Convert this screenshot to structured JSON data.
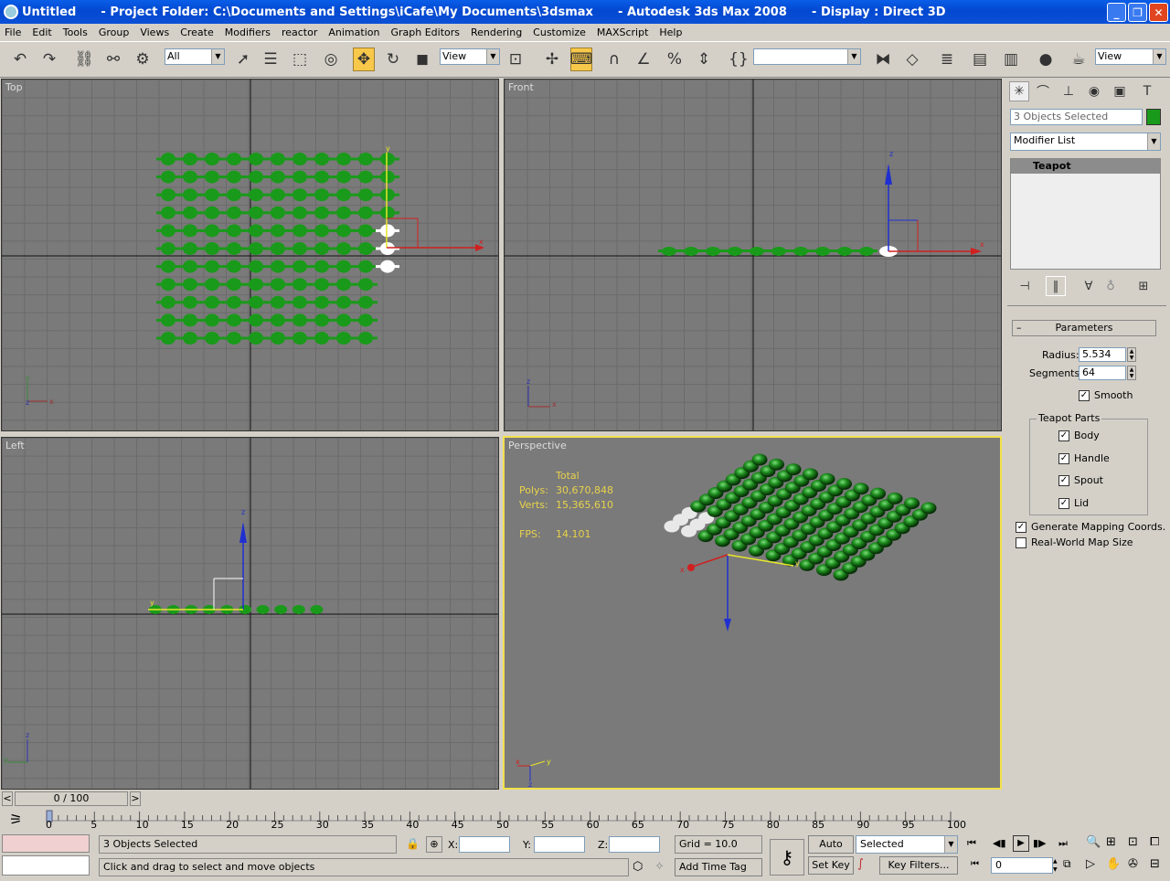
{
  "title": {
    "text": "Untitled      - Project Folder: C:\\Documents and Settings\\iCafe\\My Documents\\3dsmax      - Autodesk 3ds Max 2008      - Display : Direct 3D"
  },
  "menu": [
    "File",
    "Edit",
    "Tools",
    "Group",
    "Views",
    "Create",
    "Modifiers",
    "reactor",
    "Animation",
    "Graph Editors",
    "Rendering",
    "Customize",
    "MAXScript",
    "Help"
  ],
  "toolbar": {
    "filter": "All",
    "coord": "View",
    "coord2": "View"
  },
  "viewports": {
    "top": "Top",
    "front": "Front",
    "left": "Left",
    "perspective": "Perspective"
  },
  "stats": {
    "total": "Total",
    "polys_label": "Polys:",
    "polys": "30,670,848",
    "verts_label": "Verts:",
    "verts": "15,365,610",
    "fps_label": "FPS:",
    "fps": "14.101"
  },
  "panel": {
    "selection": "3 Objects Selected",
    "modifier_list": "Modifier List",
    "stack_item": "Teapot",
    "params_title": "Parameters",
    "radius_label": "Radius:",
    "radius": "5.534",
    "segments_label": "Segments:",
    "segments": "64",
    "smooth": "Smooth",
    "parts_title": "Teapot Parts",
    "body": "Body",
    "handle": "Handle",
    "spout": "Spout",
    "lid": "Lid",
    "gen_map": "Generate Mapping Coords.",
    "real_world": "Real-World Map Size",
    "accent": "#1a9a1a"
  },
  "timeline": {
    "position": "0 / 100",
    "ticks": [
      "0",
      "5",
      "10",
      "15",
      "20",
      "25",
      "30",
      "35",
      "40",
      "45",
      "50",
      "55",
      "60",
      "65",
      "70",
      "75",
      "80",
      "85",
      "90",
      "95",
      "100"
    ]
  },
  "status": {
    "selected": "3 Objects Selected",
    "prompt": "Click and drag to select and move objects",
    "x": "X:",
    "y": "Y:",
    "z": "Z:",
    "grid": "Grid = 10.0",
    "add_time_tag": "Add Time Tag",
    "auto_key": "Auto Key",
    "set_key": "Set Key",
    "key_mode": "Selected",
    "key_filters": "Key Filters...",
    "frame": "0"
  },
  "colors": {
    "viewport_bg": "#7a7a7a",
    "teapot": "#1a9a1a",
    "active_border": "#f3e14a"
  }
}
